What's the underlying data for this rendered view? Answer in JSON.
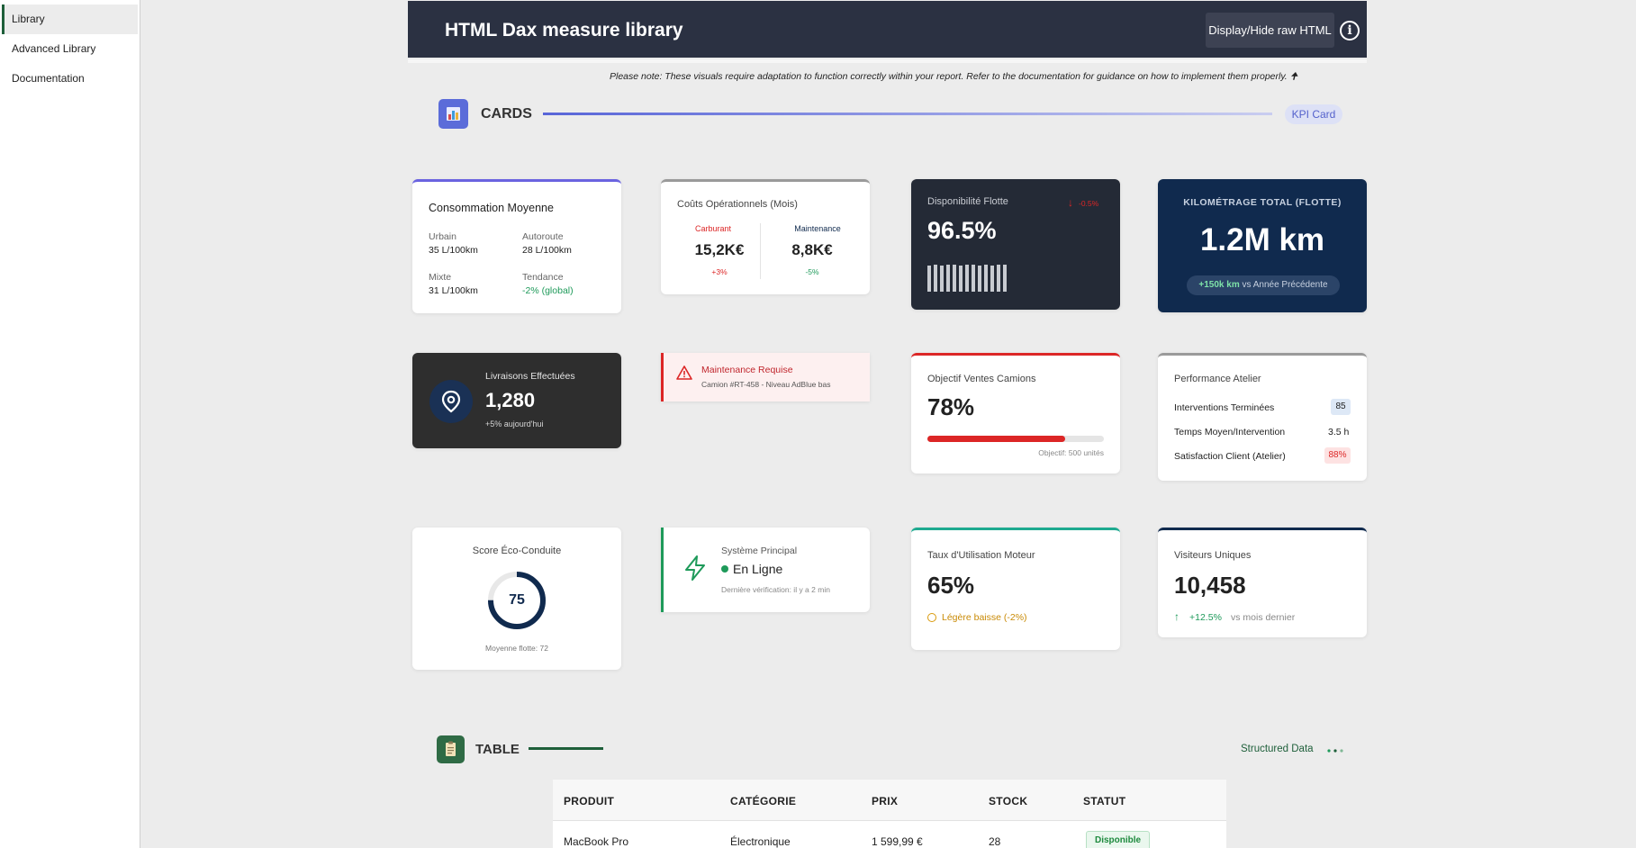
{
  "sidebar": {
    "items": [
      {
        "label": "Library"
      },
      {
        "label": "Advanced Library"
      },
      {
        "label": "Documentation"
      }
    ]
  },
  "header": {
    "title": "HTML Dax measure library",
    "raw_button": "Display/Hide raw HTML",
    "info_icon": "i"
  },
  "note": "Please note: These visuals require adaptation to function correctly within your report. Refer to the documentation for guidance on how to implement them properly. 🠉",
  "cards_section": {
    "title": "CARDS",
    "pill": "KPI Card"
  },
  "consommation": {
    "title": "Consommation Moyenne",
    "urbain_label": "Urbain",
    "urbain_value": "35 L/100km",
    "autoroute_label": "Autoroute",
    "autoroute_value": "28 L/100km",
    "mixte_label": "Mixte",
    "mixte_value": "31 L/100km",
    "tendance_label": "Tendance",
    "tendance_value": "-2% (global)"
  },
  "couts": {
    "title": "Coûts Opérationnels (Mois)",
    "carburant_label": "Carburant",
    "carburant_value": "15,2K€",
    "carburant_delta": "+3%",
    "maintenance_label": "Maintenance",
    "maintenance_value": "8,8K€",
    "maintenance_delta": "-5%"
  },
  "disponibilite": {
    "title": "Disponibilité Flotte",
    "delta": "-0.5%",
    "value": "96.5%",
    "bars": [
      0.9,
      0.95,
      0.9,
      0.95,
      0.95,
      0.9,
      0.95,
      0.95,
      0.9,
      0.95,
      0.92,
      0.95,
      0.95
    ]
  },
  "kilometrage": {
    "title": "KILOMÉTRAGE TOTAL (FLOTTE)",
    "value": "1.2M km",
    "badge_bold": "+150k km",
    "badge_text": " vs Année Précédente"
  },
  "livraisons": {
    "title": "Livraisons Effectuées",
    "value": "1,280",
    "sub": "+5% aujourd'hui"
  },
  "maintenance_alert": {
    "title": "Maintenance Requise",
    "sub": "Camion #RT-458 - Niveau AdBlue bas"
  },
  "objectif": {
    "title": "Objectif Ventes Camions",
    "value": "78%",
    "progress": 0.78,
    "target": "Objectif: 500 unités"
  },
  "atelier": {
    "title": "Performance Atelier",
    "rows": [
      {
        "label": "Interventions Terminées",
        "value": "85"
      },
      {
        "label": "Temps Moyen/Intervention",
        "value": "3.5 h"
      },
      {
        "label": "Satisfaction Client (Atelier)",
        "value": "88%"
      }
    ]
  },
  "eco": {
    "title": "Score Éco-Conduite",
    "value": "75",
    "progress": 0.75,
    "sub": "Moyenne flotte: 72"
  },
  "systeme": {
    "title": "Système Principal",
    "status": "En Ligne",
    "sub": "Dernière vérification: il y a 2 min"
  },
  "moteur": {
    "title": "Taux d'Utilisation Moteur",
    "value": "65%",
    "note": "Légère baisse (-2%)"
  },
  "visiteurs": {
    "title": "Visiteurs Uniques",
    "value": "10,458",
    "delta": "+12.5%",
    "delta_text": "vs mois dernier"
  },
  "table_section": {
    "title": "TABLE",
    "structured": "Structured Data",
    "headers": [
      "PRODUIT",
      "CATÉGORIE",
      "PRIX",
      "STOCK",
      "STATUT"
    ],
    "rows": [
      [
        "MacBook Pro",
        "Électronique",
        "1 599,99 €",
        "28",
        "Disponible"
      ]
    ]
  },
  "colors": {
    "header_bg": "#2b3142",
    "accent_blue": "#5865d8",
    "accent_green": "#1e5f3a",
    "danger": "#dc2626",
    "success": "#1e9a5a",
    "navy": "#102a4e"
  }
}
